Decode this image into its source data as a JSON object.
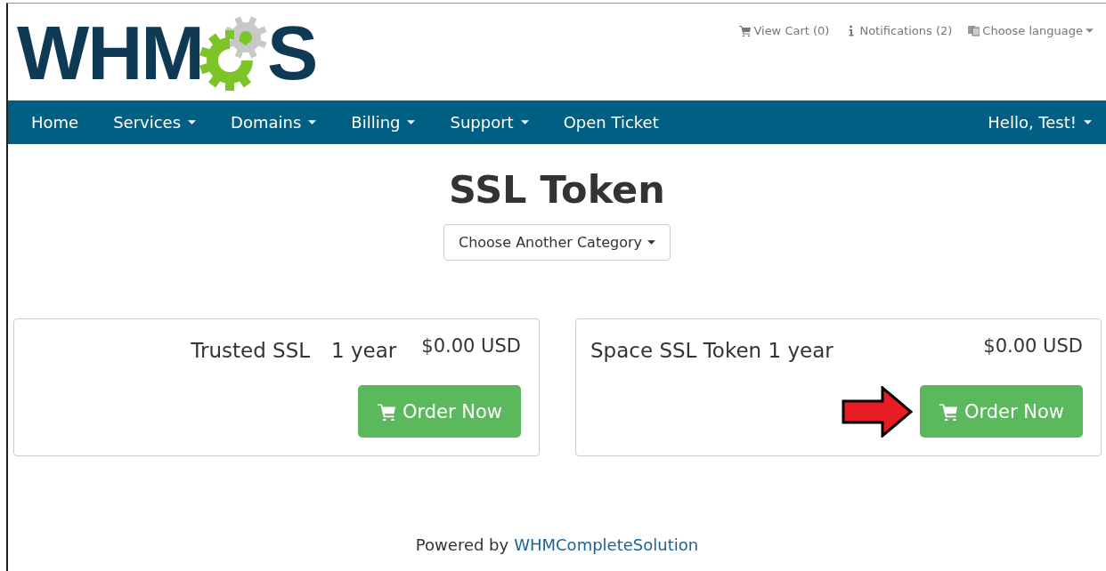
{
  "logo": {
    "before": "WHM",
    "after": "S"
  },
  "top_links": [
    {
      "kind": "cart",
      "label": "View Cart (0)",
      "caret": false
    },
    {
      "kind": "info",
      "label": "Notifications (2)",
      "caret": false
    },
    {
      "kind": "language",
      "label": "Choose language",
      "caret": true
    }
  ],
  "nav": {
    "items": [
      {
        "label": "Home",
        "caret": false
      },
      {
        "label": "Services",
        "caret": true
      },
      {
        "label": "Domains",
        "caret": true
      },
      {
        "label": "Billing",
        "caret": true
      },
      {
        "label": "Support",
        "caret": true
      },
      {
        "label": "Open Ticket",
        "caret": false
      }
    ],
    "user": {
      "label": "Hello, Test!",
      "caret": true
    }
  },
  "page_title": "SSL Token",
  "category_button": "Choose Another Category",
  "products": [
    {
      "name_parts": [
        "Trusted SSL",
        "1 year"
      ],
      "kind": "spread",
      "price": "$0.00 USD",
      "button": "Order Now",
      "pointer_arrow": false
    },
    {
      "name_parts": [
        "Space SSL Token 1 year"
      ],
      "kind": "inline",
      "price": "$0.00 USD",
      "button": "Order Now",
      "pointer_arrow": true
    }
  ],
  "footer": {
    "text": "Powered by",
    "link": "WHMCompleteSolution"
  }
}
